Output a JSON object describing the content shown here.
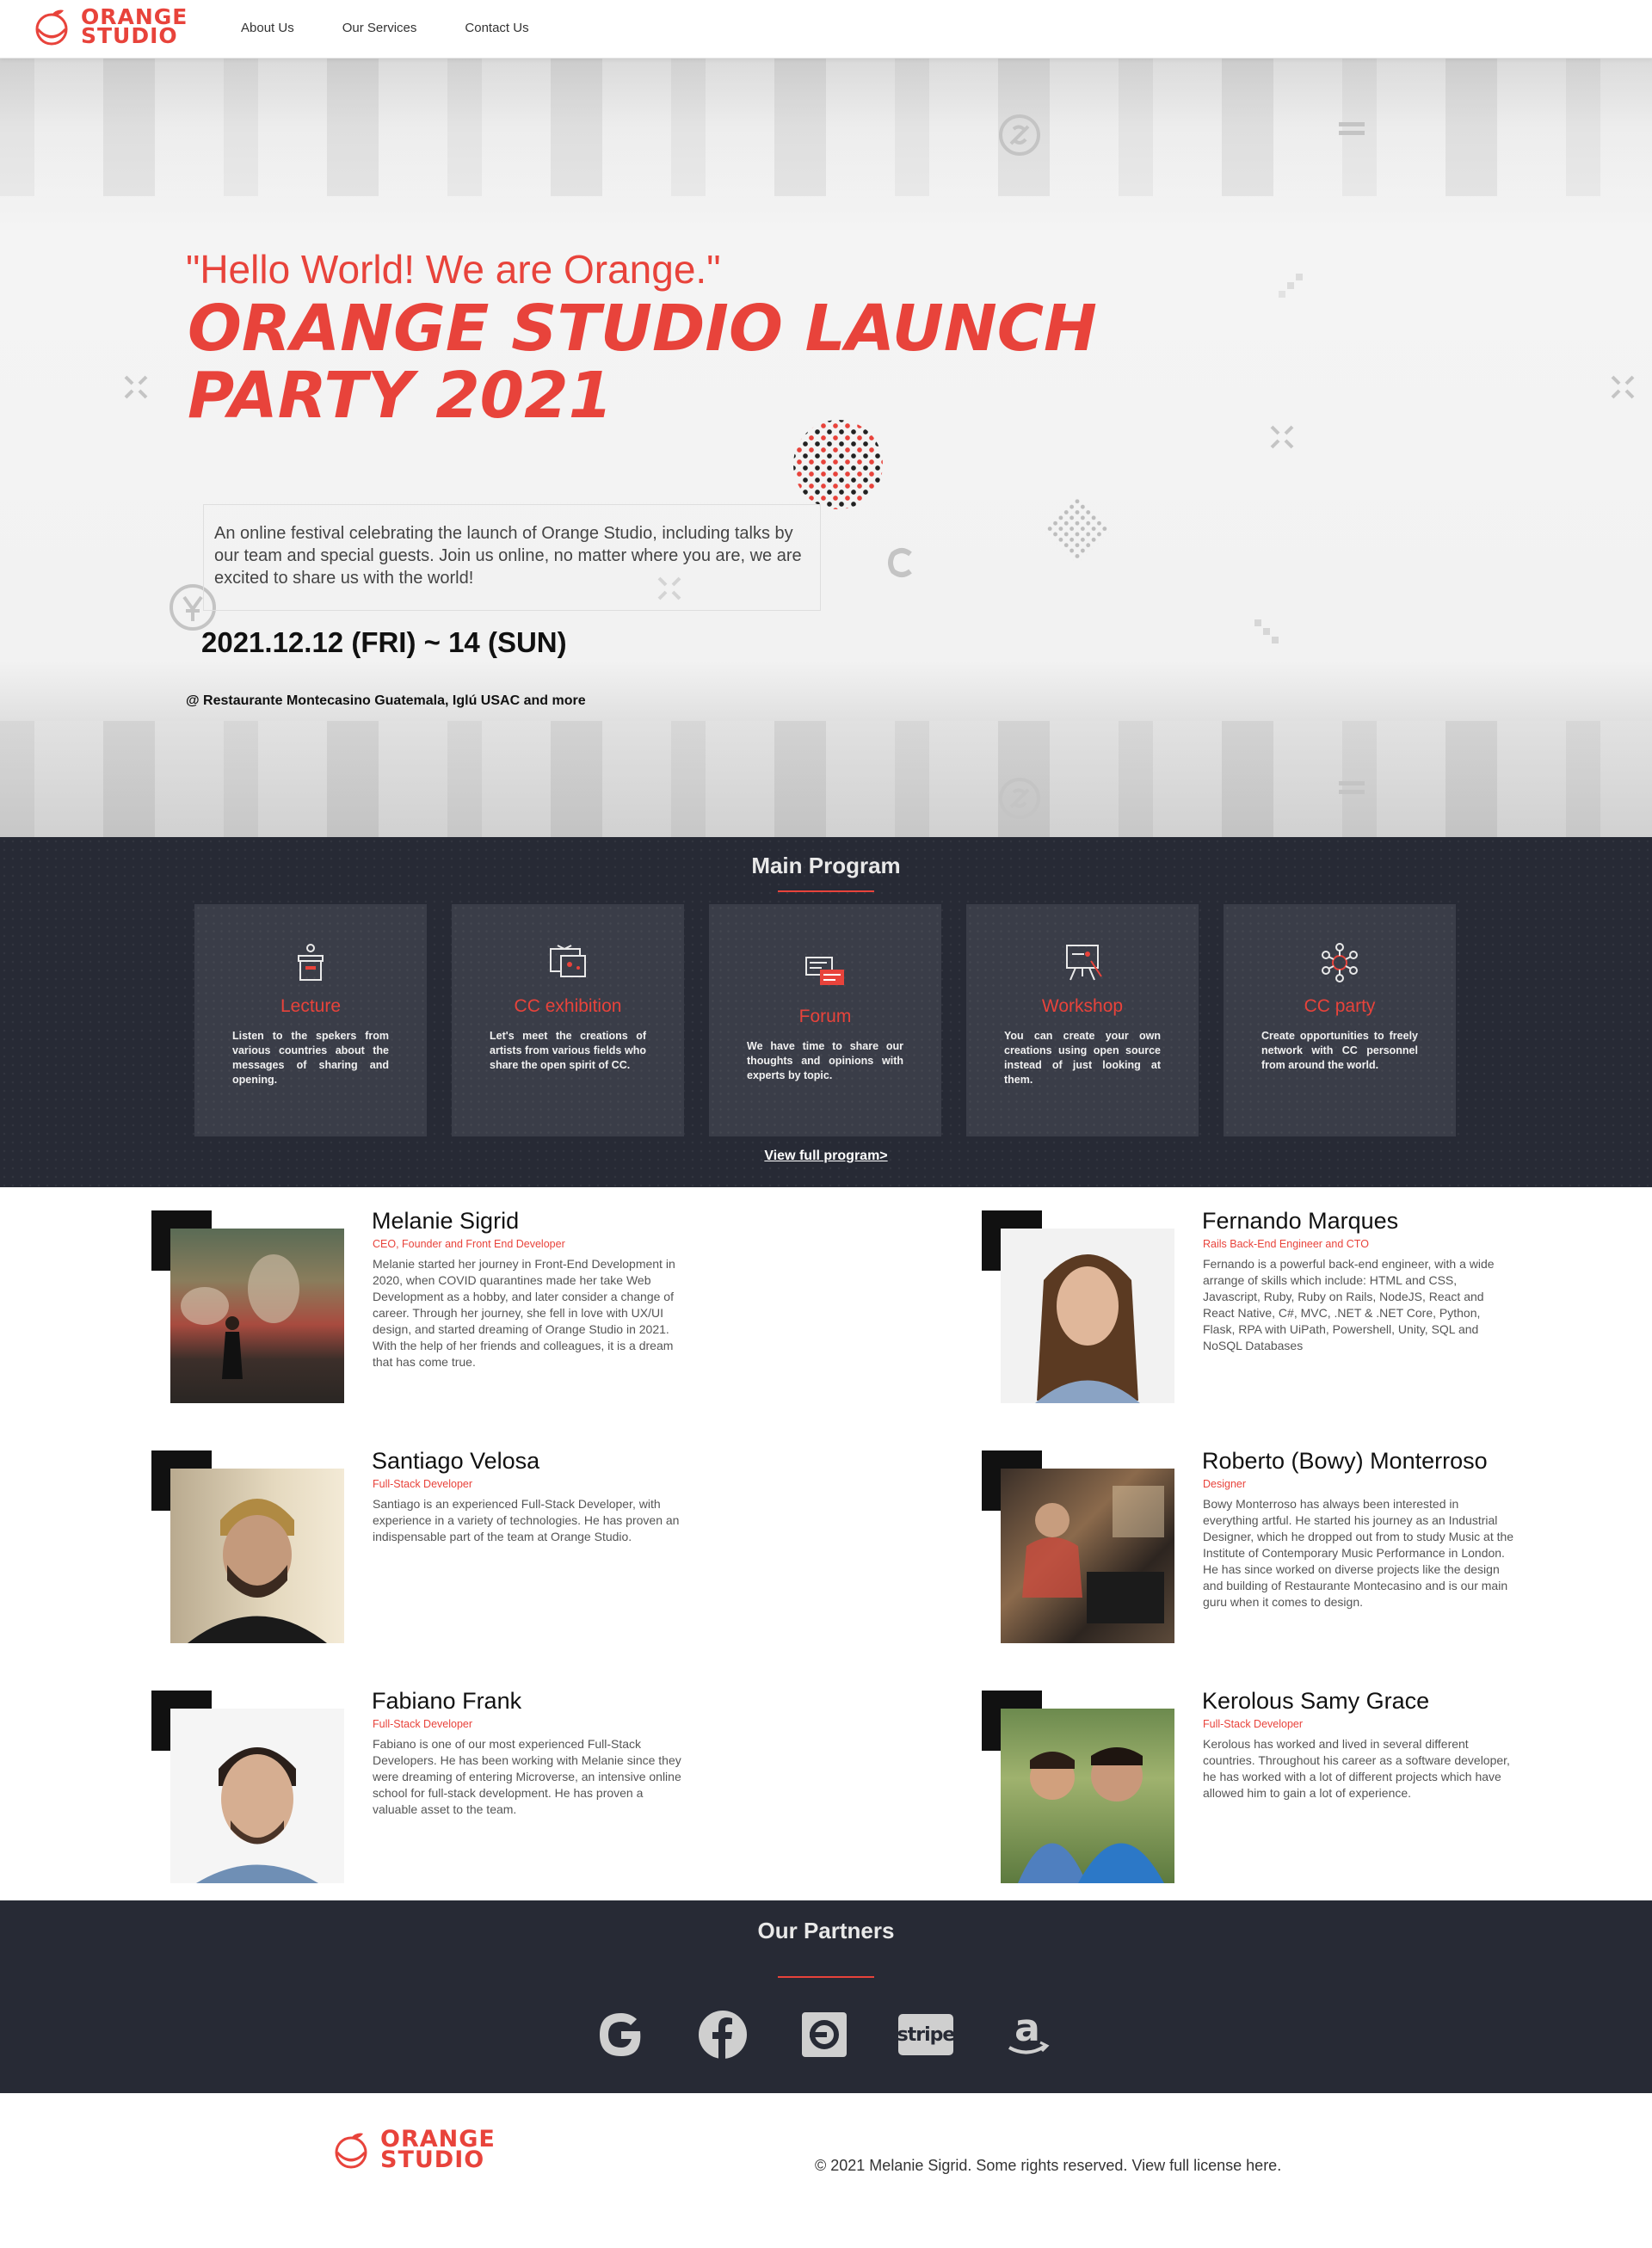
{
  "brand": {
    "logo_line1": "ORANGE",
    "logo_line2": "STUDIO",
    "accent": "#e8433b",
    "dark": "#272a35"
  },
  "nav": {
    "items": [
      "About Us",
      "Our Services",
      "Contact Us"
    ]
  },
  "hero": {
    "quote": "\"Hello World! We are Orange.\"",
    "title": "ORANGE STUDIO LAUNCH PARTY 2021",
    "description": "An online festival celebrating the launch of Orange Studio, including talks by our team and special guests. Join us online, no matter where you are, we are excited to share us with the world!",
    "date": "2021.12.12 (FRI) ~ 14 (SUN)",
    "location": "@ Restaurante Montecasino Guatemala, Iglú USAC and more"
  },
  "program": {
    "title": "Main Program",
    "cards": [
      {
        "icon": "lectern-icon",
        "title": "Lecture",
        "text": "Listen to the spekers from various countries about the messages of sharing and opening."
      },
      {
        "icon": "exhibition-board-icon",
        "title": "CC exhibition",
        "text": "Let's meet the creations of artists from various fields who share the open spirit of CC."
      },
      {
        "icon": "chat-bubbles-icon",
        "title": "Forum",
        "text": "We have time to share our thoughts and opinions with experts by topic."
      },
      {
        "icon": "presentation-icon",
        "title": "Workshop",
        "text": "You can create your own creations using open source instead of just looking at them."
      },
      {
        "icon": "network-icon",
        "title": "CC party",
        "text": "Create opportunities to freely network with CC personnel from around the world."
      }
    ],
    "view_link": "View full program>"
  },
  "team": [
    {
      "name": "Melanie Sigrid",
      "role": "CEO, Founder and Front End Developer",
      "bio": "Melanie started her journey in Front-End Development in 2020, when COVID quarantines made her take Web Development as a hobby, and later consider a change of career. Through her journey, she fell in love with UX/UI design, and started dreaming of Orange Studio in 2021. With the help of her friends and colleagues, it is a dream that has come true."
    },
    {
      "name": "Fernando Marques",
      "role": "Rails Back-End Engineer and CTO",
      "bio": "Fernando is a powerful back-end engineer, with a wide arrange of skills which include: HTML and CSS, Javascript, Ruby, Ruby on Rails, NodeJS, React and React Native, C#, MVC, .NET & .NET Core, Python, Flask, RPA with UiPath, Powershell, Unity, SQL and NoSQL Databases"
    },
    {
      "name": "Santiago Velosa",
      "role": "Full-Stack Developer",
      "bio": "Santiago is an experienced Full-Stack Developer, with experience in a variety of technologies. He has proven an indispensable part of the team at Orange Studio."
    },
    {
      "name": "Roberto (Bowy) Monterroso",
      "role": "Designer",
      "bio": "Bowy Monterroso has always been interested in everything artful. He started his journey as an Industrial Designer, which he dropped out from to study Music at the Institute of Contemporary Music Performance in London. He has since worked on diverse projects like the design and building of Restaurante Montecasino and is our main guru when it comes to design."
    },
    {
      "name": "Fabiano Frank",
      "role": "Full-Stack Developer",
      "bio": "Fabiano is one of our most experienced Full-Stack Developers. He has been working with Melanie since they were dreaming of entering Microverse, an intensive online school for full-stack development. He has proven a valuable asset to the team."
    },
    {
      "name": "Kerolous Samy Grace",
      "role": "Full-Stack Developer",
      "bio": "Kerolous has worked and lived in several different countries. Throughout his career as a software developer, he has worked with a lot of different projects which have allowed him to gain a lot of experience."
    }
  ],
  "partners": {
    "title": "Our Partners",
    "logos": [
      "google-logo-icon",
      "facebook-logo-icon",
      "daum-logo-icon",
      "stripe-logo-icon",
      "amazon-logo-icon"
    ],
    "stripe_text": "stripe"
  },
  "footer": {
    "copyright": "© 2021 Melanie Sigrid. Some rights reserved. View full license here."
  }
}
